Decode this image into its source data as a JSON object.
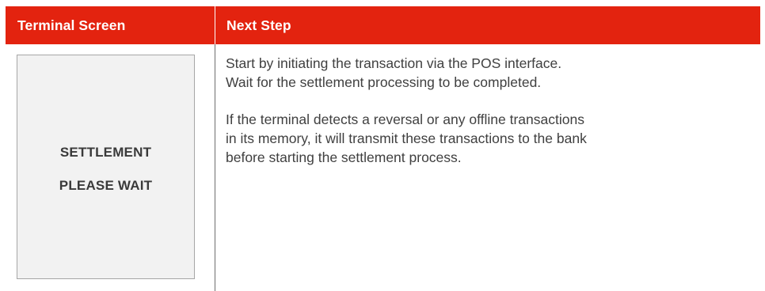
{
  "header": {
    "col1_label": "Terminal Screen",
    "col2_label": "Next Step"
  },
  "terminal": {
    "line1": "SETTLEMENT",
    "line2": "PLEASE WAIT"
  },
  "steps": {
    "p1_line1": "Start by initiating the transaction via the POS interface.",
    "p1_line2": "Wait for the settlement processing to be completed.",
    "p2_line1": "If the terminal detects a reversal or any offline transactions",
    "p2_line2": "in its memory, it will transmit these transactions to the bank",
    "p2_line3": "before starting the settlement process."
  },
  "colors": {
    "header_background": "#e3230f",
    "header_text": "#ffffff",
    "terminal_background": "#f2f2f2",
    "body_text": "#404040"
  }
}
